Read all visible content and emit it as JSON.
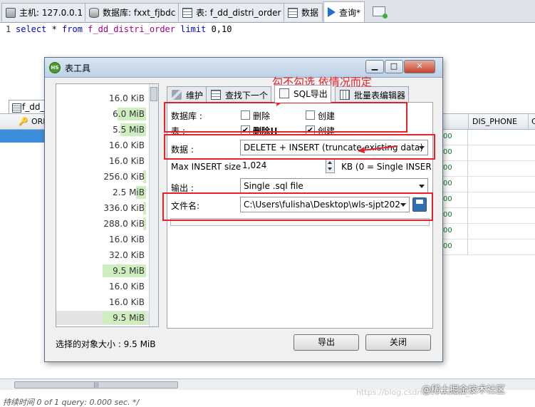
{
  "tabs": [
    {
      "label": "主机: 127.0.0.1",
      "icon": "host-icon"
    },
    {
      "label": "数据库: fxxt_fjbdc",
      "icon": "database-icon"
    },
    {
      "label": "表: f_dd_distri_order",
      "icon": "table-icon"
    },
    {
      "label": "数据",
      "icon": "data-grid-icon"
    },
    {
      "label": "查询*",
      "icon": "play-icon"
    }
  ],
  "editor": {
    "line_number": "1",
    "tokens": {
      "select": "select",
      "star": " * ",
      "from": "from",
      "table": " f_dd_distri_order ",
      "limit": "limit",
      "range": " 0,10"
    }
  },
  "result": {
    "tab_label": "f_dd_",
    "columns": [
      "ORI",
      "DIS_PHONE",
      "C"
    ],
    "row_marks": [
      "00",
      "00",
      "00",
      "00",
      "00",
      "00",
      "00",
      "00"
    ]
  },
  "dialog": {
    "title": "表工具",
    "window_buttons": {
      "minimize": "▁",
      "maximize": "□",
      "close": "✕"
    },
    "sizes": [
      {
        "label": "16.0 KiB",
        "fill": 0
      },
      {
        "label": "6.0 MiB",
        "fill": 0.55
      },
      {
        "label": "5.5 MiB",
        "fill": 0.5
      },
      {
        "label": "16.0 KiB",
        "fill": 0
      },
      {
        "label": "16.0 KiB",
        "fill": 0
      },
      {
        "label": "256.0 KiB",
        "fill": 0.02
      },
      {
        "label": "2.5 MiB",
        "fill": 0.2
      },
      {
        "label": "336.0 KiB",
        "fill": 0.03
      },
      {
        "label": "288.0 KiB",
        "fill": 0.03
      },
      {
        "label": "16.0 KiB",
        "fill": 0
      },
      {
        "label": "32.0 KiB",
        "fill": 0
      },
      {
        "label": "9.5 MiB",
        "fill": 0.85
      },
      {
        "label": "16.0 KiB",
        "fill": 0
      },
      {
        "label": "16.0 KiB",
        "fill": 0
      },
      {
        "label": "9.5 MiB",
        "fill": 0.85
      }
    ],
    "selected_size": "选择的对象大小 : 9.5 MiB",
    "right_tabs": [
      "维护",
      "查找下一个",
      "SQL导出",
      "批量表编辑器"
    ],
    "form": {
      "database_label": "数据库 :",
      "table_label": "表 :",
      "drop_label": "删除",
      "drop_table_label": "删除!!",
      "create_label": "创建",
      "create_table_label": "创建",
      "db_drop_checked": false,
      "db_create_checked": false,
      "table_drop_checked": true,
      "table_create_checked": true,
      "data_label": "数据 :",
      "data_value": "DELETE + INSERT (truncate existing data)",
      "max_insert_label": "Max INSERT size",
      "max_insert_value": "1,024",
      "max_insert_unit": "KB (0 = Single INSER",
      "output_label": "输出 :",
      "output_value": "Single .sql file",
      "filename_label": "文件名:",
      "filename_value": "C:\\Users\\fulisha\\Desktop\\wls-sjpt202"
    },
    "buttons": {
      "export": "导出",
      "close": "关闭"
    }
  },
  "annotation": "勾不勾选  依情况而定",
  "status_text": "持续时间 0 of 1 query: 0.000 sec. */",
  "watermark": "@稀土掘金技术社区",
  "watermark_url": "https://blog.csdn.net/weixin_4",
  "colors": {
    "annotation": "#e8202a",
    "size_bar": "#cfeec0",
    "selected_row": "#3d8edc"
  }
}
